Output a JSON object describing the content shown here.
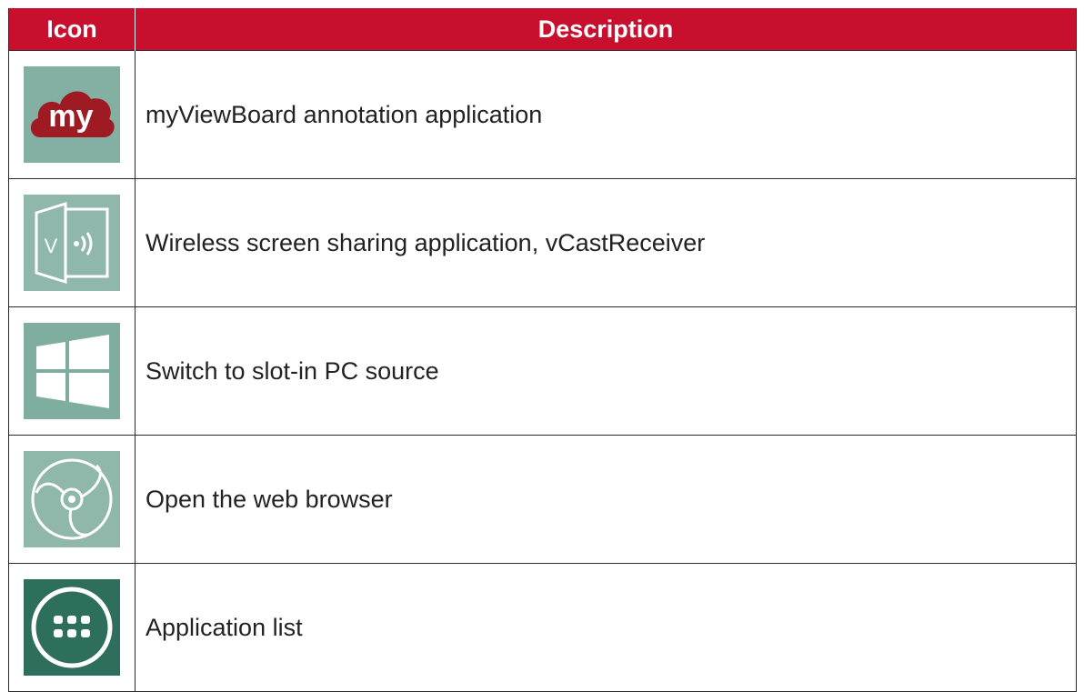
{
  "table": {
    "headers": {
      "icon": "Icon",
      "description": "Description"
    },
    "rows": [
      {
        "icon": "myviewboard-icon",
        "icon_text": "my",
        "description": "myViewBoard annotation application"
      },
      {
        "icon": "vcast-receiver-icon",
        "icon_text": "V",
        "description": "Wireless screen sharing application, vCastReceiver"
      },
      {
        "icon": "windows-logo-icon",
        "description": "Switch to slot-in PC source"
      },
      {
        "icon": "web-browser-icon",
        "description": "Open the web browser"
      },
      {
        "icon": "app-grid-icon",
        "description": "Application list"
      }
    ]
  },
  "colors": {
    "header_bg": "#c8102e",
    "header_text": "#ffffff",
    "icon_tile": "#7fada0",
    "icon_tile_dark": "#2e6e5d",
    "brand_red": "#9e1b24"
  }
}
